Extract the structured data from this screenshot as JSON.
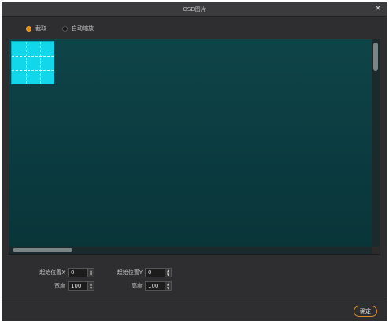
{
  "window": {
    "title": "OSD图片",
    "close_glyph": "✕"
  },
  "mode": {
    "options": [
      {
        "label": "截取",
        "selected": true
      },
      {
        "label": "自动缩放",
        "selected": false
      }
    ]
  },
  "params": {
    "start_x": {
      "label": "起始位置X",
      "value": "0"
    },
    "start_y": {
      "label": "起始位置Y",
      "value": "0"
    },
    "width": {
      "label": "宽度",
      "value": "100"
    },
    "height": {
      "label": "高度",
      "value": "100"
    },
    "spin_up": "▲",
    "spin_down": "▼"
  },
  "footer": {
    "ok_label": "确定"
  },
  "colors": {
    "canvas": "#0b3f44",
    "selection": "#12d6e9",
    "accent": "#e08a1c"
  }
}
